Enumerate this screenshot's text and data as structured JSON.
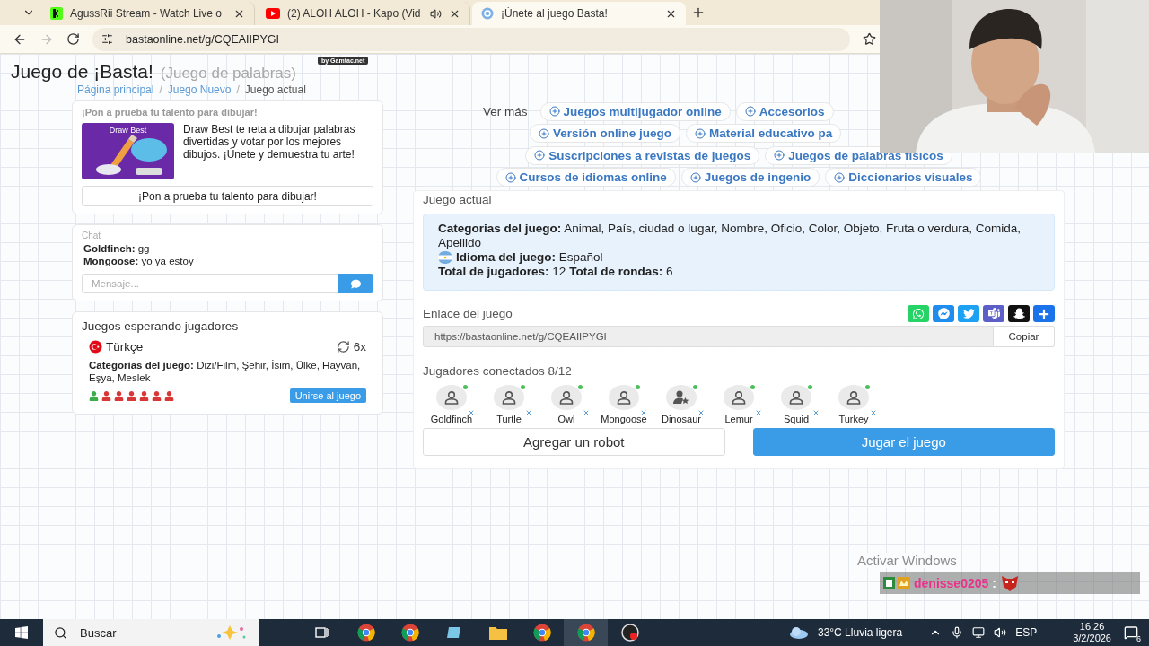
{
  "browser": {
    "tabs": [
      {
        "kind": "kick",
        "title": "AgussRii Stream - Watch Live o",
        "selected": false,
        "audio": false
      },
      {
        "kind": "youtube",
        "title": "(2) ALOH ALOH - Kapo (Vid",
        "selected": false,
        "audio": true
      },
      {
        "kind": "basta",
        "title": "¡Únete al juego Basta!",
        "selected": true,
        "audio": false
      }
    ],
    "address": "bastaonline.net/g/CQEAIIPYGI"
  },
  "header": {
    "title": "Juego de ¡Basta!",
    "subtitle": "(Juego de palabras)",
    "badge": "by Gamtac.net"
  },
  "breadcrumb": [
    {
      "label": "Página principal",
      "current": false
    },
    {
      "label": "Juego Nuevo",
      "current": false,
      "separator": "/"
    },
    {
      "label": "Juego actual",
      "current": true,
      "separator": "/"
    }
  ],
  "promo": {
    "heading": "¡Pon a prueba tu talento para dibujar!",
    "image_title": "Draw Best",
    "text": "Draw Best te reta a dibujar palabras divertidas y votar por los mejores dibujos. ¡Únete y demuestra tu arte!",
    "button": "¡Pon a prueba tu talento para dibujar!"
  },
  "chat": {
    "heading": "Chat",
    "messages": [
      {
        "author": "Goldfinch:",
        "text": "gg"
      },
      {
        "author": "Mongoose:",
        "text": "yo ya estoy"
      }
    ],
    "placeholder": "Mensaje..."
  },
  "waiting": {
    "heading": "Juegos esperando jugadores",
    "games": [
      {
        "flag": {
          "kind": "turkey"
        },
        "language": "Türkçe",
        "rounds": "6x",
        "categories_label": "Categorias del juego:",
        "categories": "Dizi/Film, Şehir, İsim, Ülke, Hayvan, Eşya, Meslek",
        "slots": [
          {
            "filled": true
          },
          {
            "filled": false
          },
          {
            "filled": false
          },
          {
            "filled": false
          },
          {
            "filled": false
          },
          {
            "filled": false
          },
          {
            "filled": false
          }
        ],
        "button": "Unirse al juego"
      }
    ]
  },
  "more": {
    "label": "Ver más",
    "rows": [
      [
        "Juegos multijugador online",
        "Accesorios"
      ],
      [
        "Versión online juego",
        "Material educativo pa"
      ],
      [
        "Suscripciones a revistas de juegos",
        "Juegos de palabras físicos"
      ],
      [
        "Cursos de idiomas online",
        "Juegos de ingenio",
        "Diccionarios visuales"
      ]
    ]
  },
  "current": {
    "heading": "Juego actual",
    "info": [
      [
        {
          "label": "Categorias del juego:",
          "value": "Animal, País, ciudad o lugar, Nombre, Oficio, Color, Objeto, Fruta o verdura, Comida, Apellido"
        }
      ],
      [
        {
          "label": "Idioma del juego:",
          "value": "Español",
          "flag": {
            "kind": "argentina"
          }
        }
      ],
      [
        {
          "label": "Total de jugadores:",
          "value": "12"
        },
        {
          "label": "Total de rondas:",
          "value": "6"
        }
      ]
    ],
    "link_label": "Enlace del juego",
    "link": "https://bastaonline.net/g/CQEAIIPYGI",
    "copy": "Copiar",
    "players_label": "Jugadores conectados 8/12",
    "players": [
      {
        "name": "Goldfinch",
        "online": true,
        "host": false
      },
      {
        "name": "Turtle",
        "online": true,
        "host": false
      },
      {
        "name": "Owl",
        "online": true,
        "host": false
      },
      {
        "name": "Mongoose",
        "online": true,
        "host": false
      },
      {
        "name": "Dinosaur",
        "online": true,
        "host": true
      },
      {
        "name": "Lemur",
        "online": true,
        "host": false
      },
      {
        "name": "Squid",
        "online": true,
        "host": false
      },
      {
        "name": "Turkey",
        "online": true,
        "host": false
      }
    ],
    "add_robot": "Agregar un robot",
    "play": "Jugar el juego"
  },
  "overlay": {
    "activation": "Activar Windows",
    "chat_user": "denisse0205",
    "chat_separator": ":"
  },
  "taskbar": {
    "search": "Buscar",
    "weather": "33°C Lluvia ligera",
    "language": "ESP",
    "time": "16:26",
    "date": "3/2/2026",
    "notifications": "6"
  }
}
